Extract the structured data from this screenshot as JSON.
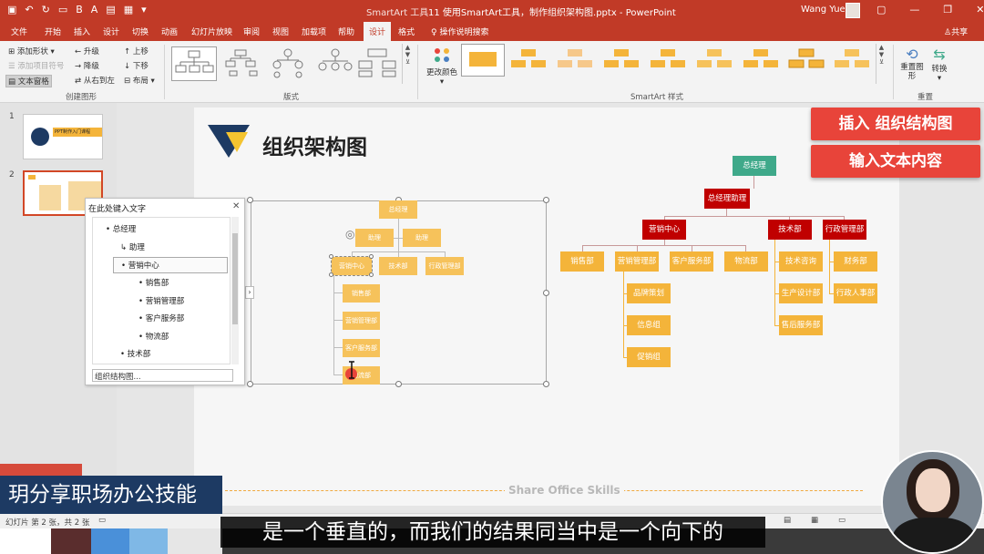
{
  "window": {
    "context_tool": "SmartArt 工具",
    "doc_title": "11 使用SmartArt工具，制作组织架构图.pptx - PowerPoint",
    "user": "Wang Yue"
  },
  "menu": {
    "tabs": [
      "文件",
      "开始",
      "插入",
      "设计",
      "切换",
      "动画",
      "幻灯片放映",
      "审阅",
      "视图",
      "加载项",
      "帮助",
      "设计",
      "格式"
    ],
    "tell_me": "操作说明搜索",
    "share": "共享"
  },
  "ribbon": {
    "create": {
      "add_shape": "添加形状",
      "add_bullet": "添加项目符号",
      "text_pane": "文本窗格",
      "promote": "升级",
      "demote": "降级",
      "rtl": "从右到左",
      "move_up": "上移",
      "move_down": "下移",
      "layout": "布局",
      "label": "创建图形"
    },
    "layouts_label": "版式",
    "change_colors": "更改颜色",
    "styles_label": "SmartArt 样式",
    "reset_graphic": "重置图形",
    "convert": "转换",
    "reset_label": "重置"
  },
  "slides_pane": {
    "numbers": [
      "1",
      "2"
    ],
    "thumb1_title": "PPT制作入门课程"
  },
  "slide": {
    "title": "组织架构图",
    "footer": "Share Office  Skills",
    "banner1": "插入 组织结构图",
    "banner2": "输入文本内容"
  },
  "text_pane": {
    "title": "在此处键入文字",
    "items": [
      {
        "text": "总经理",
        "bullet": "•"
      },
      {
        "text": "助理",
        "bullet": "↳"
      },
      {
        "text": "营销中心",
        "bullet": "•"
      },
      {
        "text": "销售部",
        "bullet": "•"
      },
      {
        "text": "营销管理部",
        "bullet": "•"
      },
      {
        "text": "客户服务部",
        "bullet": "•"
      },
      {
        "text": "物流部",
        "bullet": "•"
      },
      {
        "text": "技术部",
        "bullet": "•"
      }
    ],
    "footer": "组织结构图..."
  },
  "smartart": {
    "top": "总经理",
    "assist1": "助理",
    "assist2": "助理",
    "marketing": "营销中心",
    "tech": "技术部",
    "admin": "行政管理部",
    "sub": [
      "销售部",
      "营销管理部",
      "客户服务部",
      "物流部"
    ]
  },
  "orgchart": {
    "ceo": "总经理",
    "assistant": "总经理助理",
    "marketing": "营销中心",
    "tech": "技术部",
    "admin": "行政管理部",
    "marketing_children": [
      "销售部",
      "营销管理部",
      "客户服务部",
      "物流部"
    ],
    "mgmt_children": [
      "品牌策划",
      "信息组",
      "促销组"
    ],
    "tech_children": [
      "技术咨询",
      "生产设计部",
      "售后服务部"
    ],
    "admin_children": [
      "财务部",
      "行政人事部"
    ]
  },
  "status": {
    "slide_info": "幻灯片 第 2 张，共 2 张"
  },
  "overlay": {
    "brand": "玥分享职场办公技能",
    "subtitle": "是一个垂直的，而我们的结果同当中是一个向下的"
  },
  "colors": {
    "ribbon_red": "#c13a27",
    "node_orange": "#f4b43a",
    "node_red": "#c00000",
    "node_teal": "#3fa98a",
    "banner_red": "#e8443a"
  }
}
